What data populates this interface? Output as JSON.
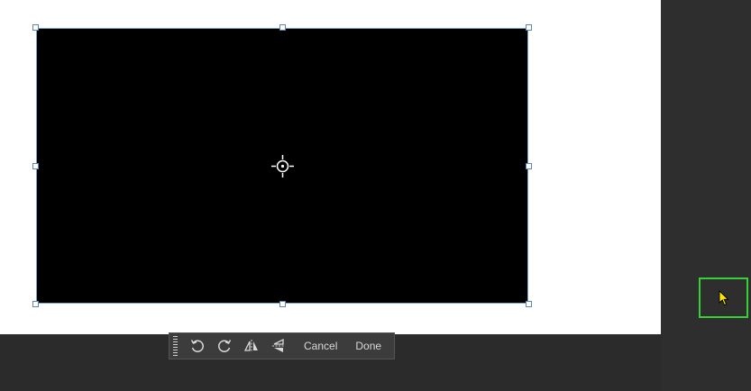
{
  "canvas": {
    "background_color": "#ffffff",
    "workspace_color": "#2b2b2b",
    "selected_image": {
      "fill_color": "#000000",
      "selection_color": "#7fa3c9",
      "center_icon": "crosshair-icon"
    }
  },
  "transform_toolbar": {
    "grip_icon": "grip-icon",
    "rotate_left_icon": "rotate-left-icon",
    "rotate_right_icon": "rotate-right-icon",
    "flip_horizontal_icon": "flip-horizontal-icon",
    "flip_vertical_icon": "flip-vertical-icon",
    "cancel_label": "Cancel",
    "done_label": "Done"
  },
  "cursor_indicator": {
    "icon": "mouse-pointer-icon",
    "highlight_color": "#36d136",
    "pointer_color": "#ffe600"
  }
}
